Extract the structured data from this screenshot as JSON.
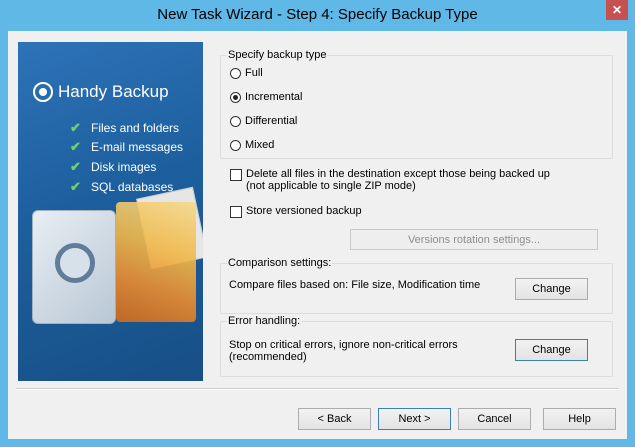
{
  "window": {
    "title": "New Task Wizard - Step 4: Specify Backup Type",
    "close_glyph": "✕"
  },
  "side_panel": {
    "brand": "Handy Backup",
    "features": [
      "Files and folders",
      "E-mail messages",
      "Disk images",
      "SQL databases"
    ]
  },
  "backup_type": {
    "title": "Specify backup type",
    "options": [
      "Full",
      "Incremental",
      "Differential",
      "Mixed"
    ],
    "selected": "Incremental"
  },
  "options": {
    "delete_files_label_line1": "Delete all files in the destination except those being backed up",
    "delete_files_label_line2": "(not applicable to single ZIP mode)",
    "delete_files_checked": false,
    "versioned_label": "Store versioned backup",
    "versioned_checked": false,
    "versions_rotation_button": "Versions rotation settings..."
  },
  "comparison": {
    "title": "Comparison settings:",
    "text": "Compare files based on: File size, Modification time",
    "change_button": "Change"
  },
  "error_handling": {
    "title": "Error handling:",
    "text_line1": "Stop on critical errors, ignore non-critical errors",
    "text_line2": "(recommended)",
    "change_button": "Change"
  },
  "footer": {
    "back": "< Back",
    "next": "Next >",
    "cancel": "Cancel",
    "help": "Help"
  }
}
